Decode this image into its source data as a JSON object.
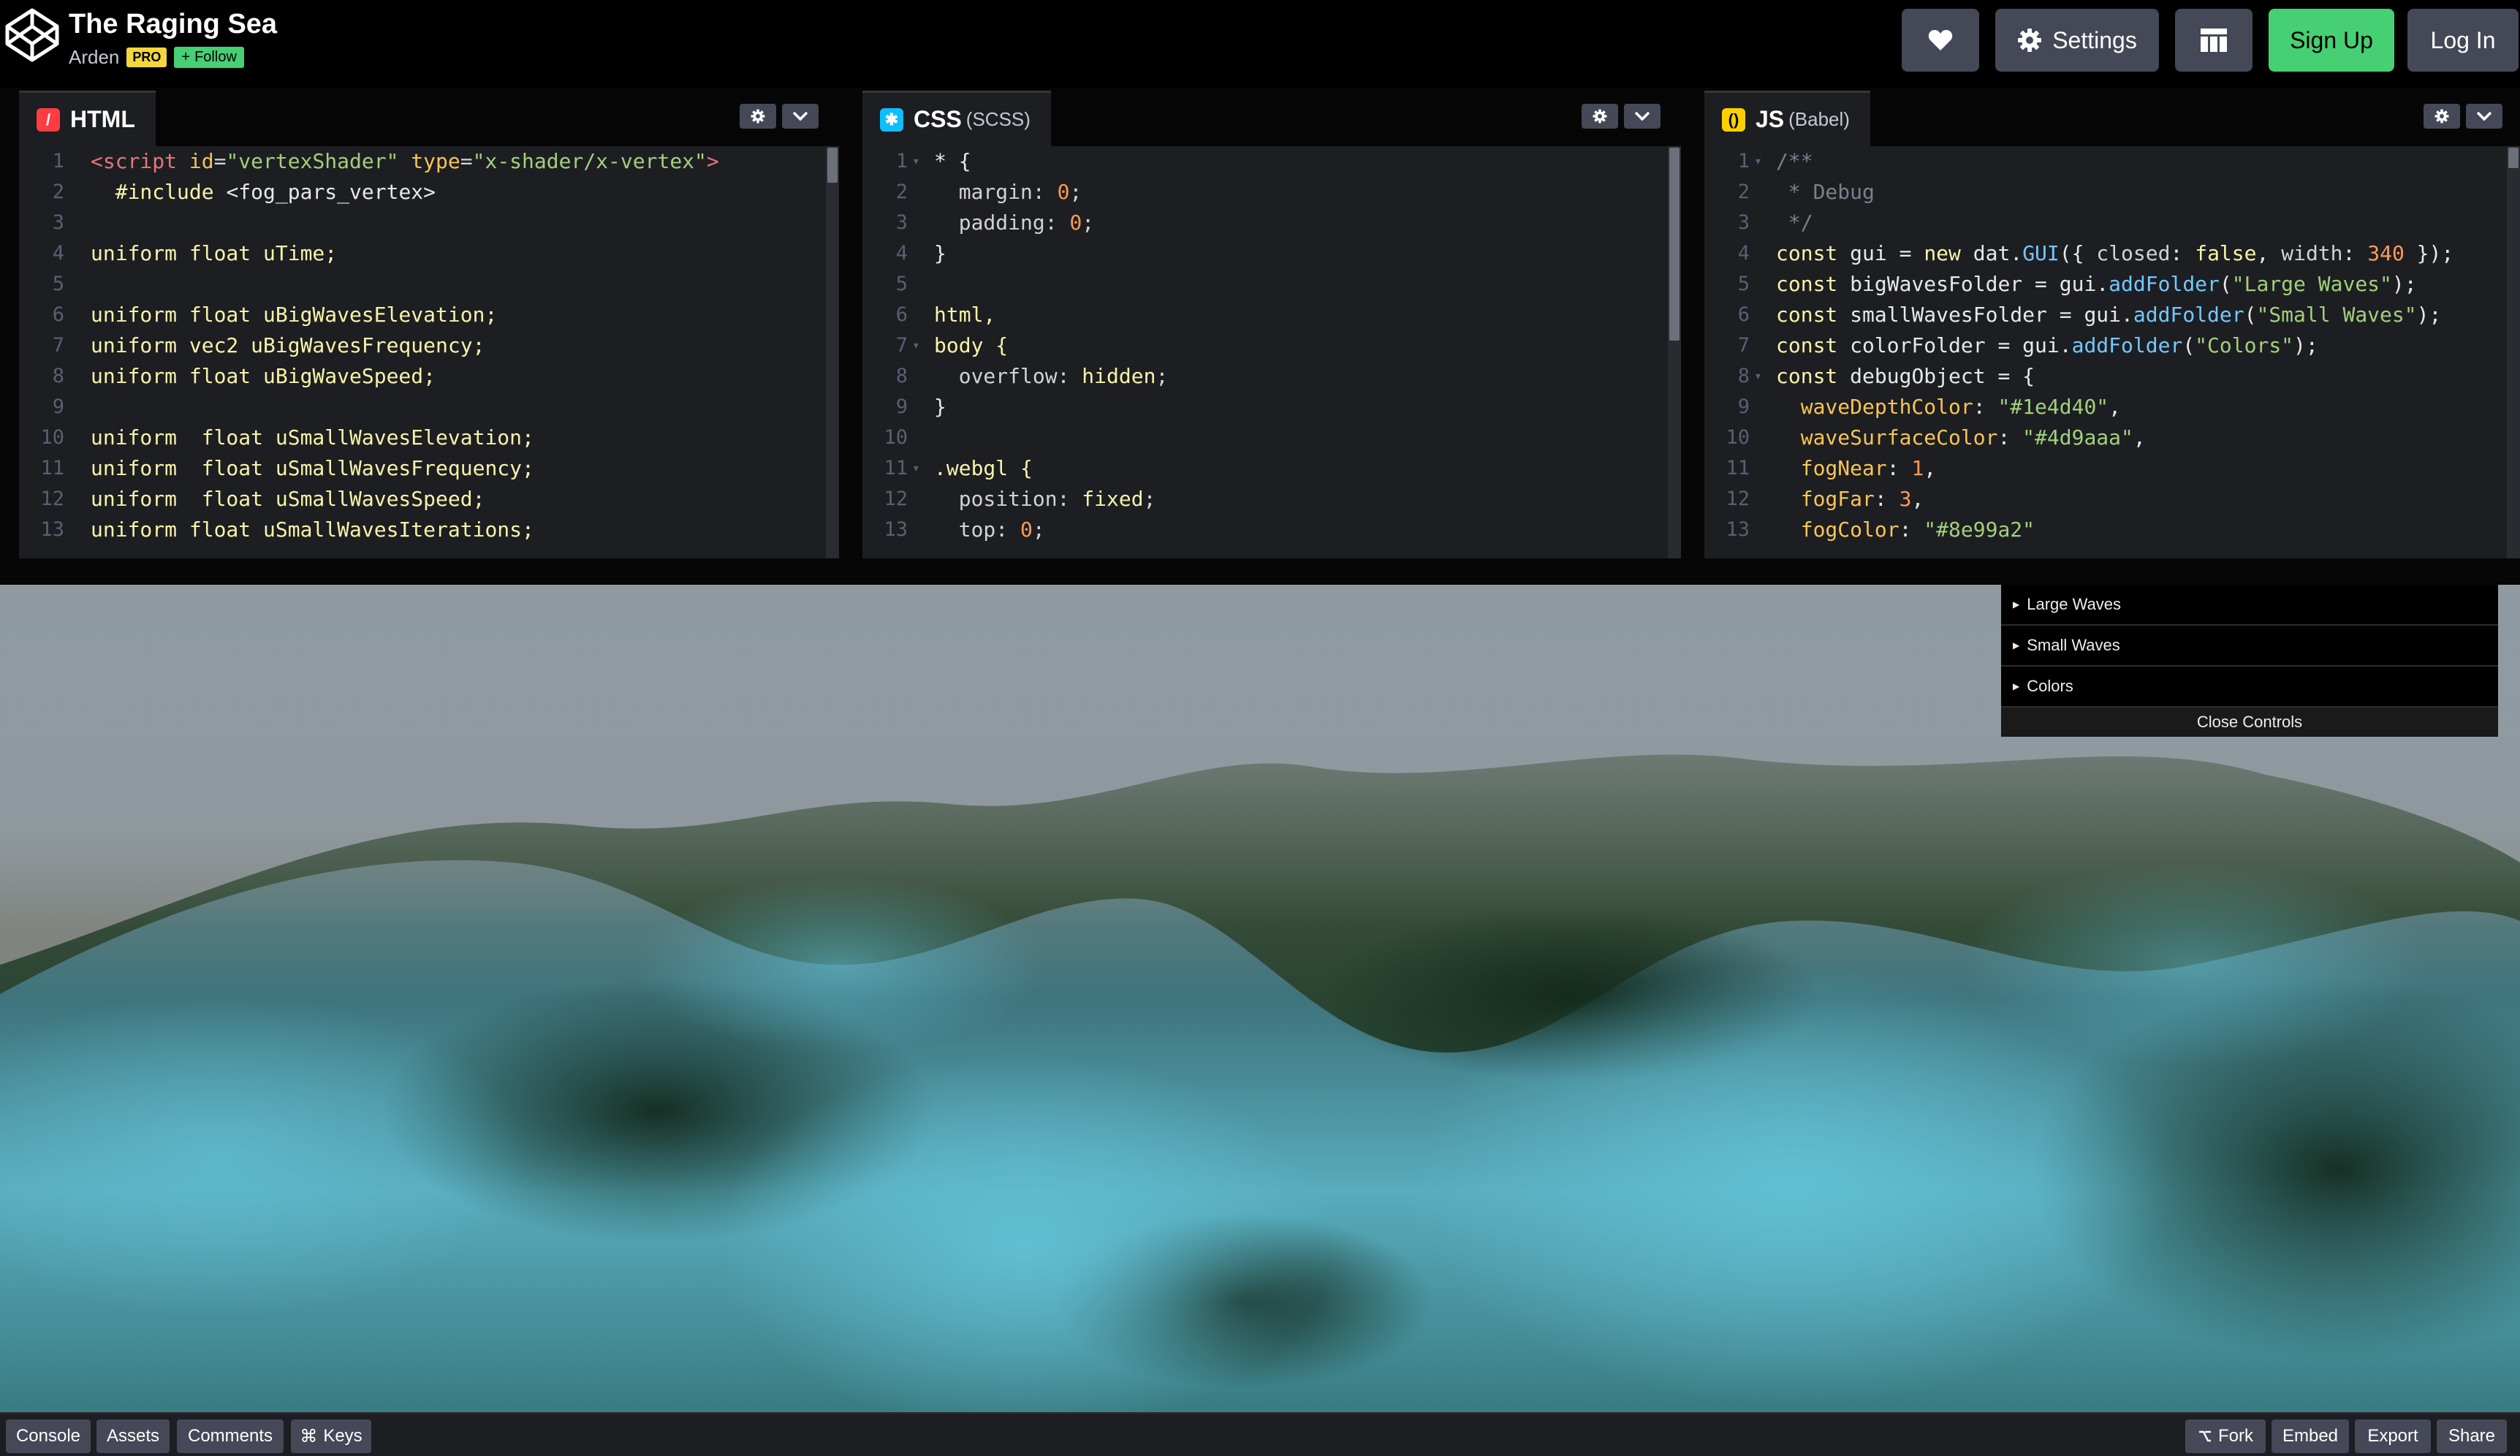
{
  "header": {
    "title": "The Raging Sea",
    "author": "Arden",
    "pro_badge": "PRO",
    "follow_label": "Follow",
    "settings_label": "Settings",
    "signup_label": "Sign Up",
    "login_label": "Log In"
  },
  "editors": {
    "html": {
      "name": "HTML",
      "sub": "",
      "lines": [
        [
          "1",
          "<script id=\"vertexShader\" type=\"x-shader/x-vertex\">"
        ],
        [
          "2",
          "  #include <fog_pars_vertex>"
        ],
        [
          "3",
          ""
        ],
        [
          "4",
          "uniform float uTime;"
        ],
        [
          "5",
          ""
        ],
        [
          "6",
          "uniform float uBigWavesElevation;"
        ],
        [
          "7",
          "uniform vec2 uBigWavesFrequency;"
        ],
        [
          "8",
          "uniform float uBigWaveSpeed;"
        ],
        [
          "9",
          ""
        ],
        [
          "10",
          "uniform  float uSmallWavesElevation;"
        ],
        [
          "11",
          "uniform  float uSmallWavesFrequency;"
        ],
        [
          "12",
          "uniform  float uSmallWavesSpeed;"
        ],
        [
          "13",
          "uniform float uSmallWavesIterations;"
        ]
      ]
    },
    "css": {
      "name": "CSS",
      "sub": "(SCSS)",
      "lines": [
        [
          "1",
          "* {"
        ],
        [
          "2",
          "  margin: 0;"
        ],
        [
          "3",
          "  padding: 0;"
        ],
        [
          "4",
          "}"
        ],
        [
          "5",
          ""
        ],
        [
          "6",
          "html,"
        ],
        [
          "7",
          "body {"
        ],
        [
          "8",
          "  overflow: hidden;"
        ],
        [
          "9",
          "}"
        ],
        [
          "10",
          ""
        ],
        [
          "11",
          ".webgl {"
        ],
        [
          "12",
          "  position: fixed;"
        ],
        [
          "13",
          "  top: 0;"
        ]
      ]
    },
    "js": {
      "name": "JS",
      "sub": "(Babel)",
      "lines": [
        [
          "1",
          "/**"
        ],
        [
          "2",
          " * Debug"
        ],
        [
          "3",
          " */"
        ],
        [
          "4",
          "const gui = new dat.GUI({ closed: false, width: 340 });"
        ],
        [
          "5",
          "const bigWavesFolder = gui.addFolder(\"Large Waves\");"
        ],
        [
          "6",
          "const smallWavesFolder = gui.addFolder(\"Small Waves\");"
        ],
        [
          "7",
          "const colorFolder = gui.addFolder(\"Colors\");"
        ],
        [
          "8",
          "const debugObject = {"
        ],
        [
          "9",
          "  waveDepthColor: \"#1e4d40\","
        ],
        [
          "10",
          "  waveSurfaceColor: \"#4d9aaa\","
        ],
        [
          "11",
          "  fogNear: 1,"
        ],
        [
          "12",
          "  fogFar: 3,"
        ],
        [
          "13",
          "  fogColor: \"#8e99a2\""
        ]
      ]
    }
  },
  "gui": {
    "folders": [
      "Large Waves",
      "Small Waves",
      "Colors"
    ],
    "close_label": "Close Controls"
  },
  "footer": {
    "left": [
      "Console",
      "Assets",
      "Comments",
      "Keys"
    ],
    "keys_symbol": "⌘",
    "right": [
      "Fork",
      "Embed",
      "Export",
      "Share"
    ]
  },
  "colors": {
    "html_icon": "#ff3c41",
    "css_icon": "#0ebeff",
    "js_icon": "#fcd000",
    "signup_green": "#47cf73",
    "wave_depth": "#1e4d40",
    "wave_surface": "#4d9aaa",
    "fog": "#8e99a2"
  }
}
